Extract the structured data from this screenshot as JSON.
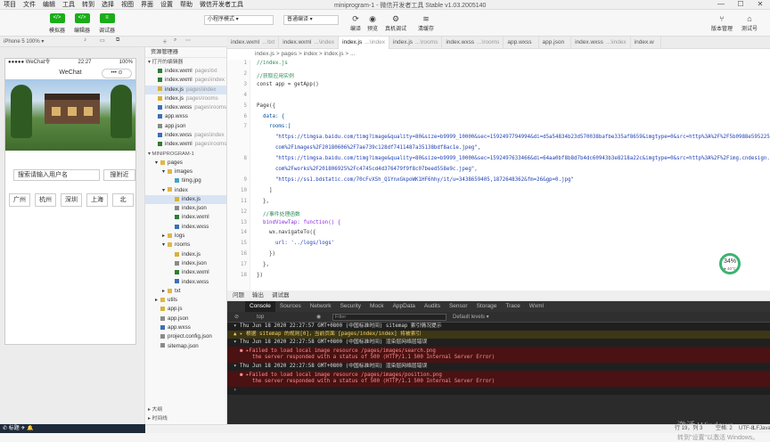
{
  "menu": [
    "项目",
    "文件",
    "编辑",
    "工具",
    "转到",
    "选择",
    "视图",
    "界面",
    "设置",
    "帮助",
    "微信开发者工具"
  ],
  "window_title": "miniprogram-1 - 微信开发者工具 Stable v1.03.2005140",
  "win_controls": {
    "min": "—",
    "max": "☐",
    "close": "✕"
  },
  "toolbar": {
    "simulator": "模拟器",
    "editor": "编辑器",
    "debugger": "调试器",
    "mode": "小程序模式",
    "compile": "普通编译",
    "compile_btn": "编译",
    "preview": "预览",
    "real_debug": "真机调试",
    "clear_cache": "清缓存",
    "version_mgmt": "版本管理",
    "test_account": "测试号",
    "icon_sim": "</>",
    "icon_ed": "</>",
    "icon_dbg": "≡"
  },
  "sim_bar": "iPhone 5 100% ▾",
  "tabs": [
    {
      "name": "index.wxml",
      "dir": "...\\txt"
    },
    {
      "name": "index.wxml",
      "dir": "...\\index"
    },
    {
      "name": "index.js",
      "dir": "...\\index"
    },
    {
      "name": "index.js",
      "dir": "...\\rooms"
    },
    {
      "name": "index.wxss",
      "dir": "...\\rooms"
    },
    {
      "name": "app.wxss",
      "dir": ""
    },
    {
      "name": "app.json",
      "dir": ""
    },
    {
      "name": "index.wxss",
      "dir": "...\\index"
    },
    {
      "name": "index.w",
      "dir": ""
    }
  ],
  "phone": {
    "carrier": "●●●●● WeChat令",
    "time": "22:27",
    "battery": "100%",
    "nav_title": "WeChat",
    "capsule": "•••  ⊙",
    "search_placeholder": "搜索请输入用户名",
    "nearby": "搜附近",
    "cities": [
      "广州",
      "杭州",
      "深圳",
      "上海",
      "北"
    ]
  },
  "explorer": {
    "title": "资源管理器",
    "open_editors": "打开的编辑器",
    "project": "MINIPROGRAM-1",
    "outline": "大纲",
    "timeline": "时间线",
    "open_files": [
      {
        "name": "index.wxml",
        "dir": "pages\\txt",
        "type": "wxml"
      },
      {
        "name": "index.wxml",
        "dir": "pages\\index",
        "type": "wxml"
      },
      {
        "name": "index.js",
        "dir": "pages\\index",
        "type": "js"
      },
      {
        "name": "index.js",
        "dir": "pages\\rooms",
        "type": "js"
      },
      {
        "name": "index.wxss",
        "dir": "pages\\rooms",
        "type": "wxss"
      },
      {
        "name": "app.wxss",
        "dir": "",
        "type": "wxss"
      },
      {
        "name": "app.json",
        "dir": "",
        "type": "json"
      },
      {
        "name": "index.wxss",
        "dir": "pages\\index",
        "type": "wxss"
      },
      {
        "name": "index.wxml",
        "dir": "pages\\rooms",
        "type": "wxml"
      }
    ],
    "tree": [
      {
        "name": "pages",
        "type": "dir",
        "indent": 1,
        "arrow": "▾"
      },
      {
        "name": "images",
        "type": "dir",
        "indent": 2,
        "arrow": "▾"
      },
      {
        "name": "timg.jpg",
        "type": "img",
        "indent": 3,
        "arrow": ""
      },
      {
        "name": "index",
        "type": "dir",
        "indent": 2,
        "arrow": "▾"
      },
      {
        "name": "index.js",
        "type": "js",
        "indent": 3,
        "arrow": "",
        "sel": true
      },
      {
        "name": "index.json",
        "type": "json",
        "indent": 3,
        "arrow": ""
      },
      {
        "name": "index.wxml",
        "type": "wxml",
        "indent": 3,
        "arrow": ""
      },
      {
        "name": "index.wxss",
        "type": "wxss",
        "indent": 3,
        "arrow": ""
      },
      {
        "name": "logs",
        "type": "dir",
        "indent": 2,
        "arrow": "▸"
      },
      {
        "name": "rooms",
        "type": "dir",
        "indent": 2,
        "arrow": "▾"
      },
      {
        "name": "index.js",
        "type": "js",
        "indent": 3,
        "arrow": ""
      },
      {
        "name": "index.json",
        "type": "json",
        "indent": 3,
        "arrow": ""
      },
      {
        "name": "index.wxml",
        "type": "wxml",
        "indent": 3,
        "arrow": ""
      },
      {
        "name": "index.wxss",
        "type": "wxss",
        "indent": 3,
        "arrow": ""
      },
      {
        "name": "txt",
        "type": "dir",
        "indent": 2,
        "arrow": "▸"
      },
      {
        "name": "utils",
        "type": "dir",
        "indent": 1,
        "arrow": "▸"
      },
      {
        "name": "app.js",
        "type": "js",
        "indent": 1,
        "arrow": ""
      },
      {
        "name": "app.json",
        "type": "json",
        "indent": 1,
        "arrow": ""
      },
      {
        "name": "app.wxss",
        "type": "wxss",
        "indent": 1,
        "arrow": ""
      },
      {
        "name": "project.config.json",
        "type": "json",
        "indent": 1,
        "arrow": ""
      },
      {
        "name": "sitemap.json",
        "type": "json",
        "indent": 1,
        "arrow": ""
      }
    ]
  },
  "editor": {
    "breadcrumb": "index.js  >  pages  >  index  >  index.js  >  ...",
    "code": [
      {
        "ln": "1",
        "t": "//index.js",
        "c": "c-com"
      },
      {
        "ln": "2",
        "t": "//获取应用实例",
        "c": "c-com"
      },
      {
        "ln": "3",
        "t": "const app = getApp()",
        "c": ""
      },
      {
        "ln": "4",
        "t": "",
        "c": ""
      },
      {
        "ln": "5",
        "t": "Page({",
        "c": ""
      },
      {
        "ln": "6",
        "t": "  data: {",
        "c": "c-key"
      },
      {
        "ln": "7",
        "t": "    rooms:[",
        "c": "c-key"
      },
      {
        "ln": "",
        "t": "      \"https://timgsa.baidu.com/timg?image&quality=80&size=b9999_10000&sec=1592497794994&di=d5a54834b23d570038bafbe335af8659&imgtype=0&src=http%3A%2F%2F5b0988e595225.cdn.sohucs.",
        "c": "c-str"
      },
      {
        "ln": "",
        "t": "      com%2Fimages%2F20180606%2F7ae739c128df7411487a35138bdf8ac1e.jpeg\",",
        "c": "c-str"
      },
      {
        "ln": "8",
        "t": "      \"https://timgsa.baidu.com/timg?image&quality=80&size=b9999_10000&sec=1592497633466&di=64aa0bf8b8d7b4dc60943b3e8218a22c&imgtype=0&src=http%3A%2F%2Fimg.cndesign.",
        "c": "c-str"
      },
      {
        "ln": "",
        "t": "      com%2Fworks%2F201806925%2Fc4745cd4d376479f9f8c07beed558e9c.jpeg\",",
        "c": "c-str"
      },
      {
        "ln": "9",
        "t": "      \"https://ss1.bdstatic.com/70cFvXSh_Q1YnxGkpoWK1HF6hhy/it/u=3438659405,1872648362&fm=26&gp=0.jpg\"",
        "c": "c-str"
      },
      {
        "ln": "10",
        "t": "    ]",
        "c": ""
      },
      {
        "ln": "11",
        "t": "  },",
        "c": ""
      },
      {
        "ln": "12",
        "t": "  //事件处理函数",
        "c": "c-com"
      },
      {
        "ln": "13",
        "t": "  bindViewTap: function() {",
        "c": "c-kw"
      },
      {
        "ln": "14",
        "t": "    wx.navigateTo({",
        "c": ""
      },
      {
        "ln": "15",
        "t": "      url: '../logs/logs'",
        "c": "c-str"
      },
      {
        "ln": "16",
        "t": "    })",
        "c": ""
      },
      {
        "ln": "17",
        "t": "  },",
        "c": ""
      },
      {
        "ln": "18",
        "t": "})",
        "c": ""
      }
    ]
  },
  "perf": {
    "percent": "34%",
    "label": "● 40°C"
  },
  "devtools": {
    "top_tabs": [
      "问题",
      "输出",
      "调试器"
    ],
    "tabs": [
      "Console",
      "Sources",
      "Network",
      "Security",
      "Mock",
      "AppData",
      "Audits",
      "Sensor",
      "Storage",
      "Trace",
      "Wxml"
    ],
    "context": "top",
    "filter_placeholder": "Filter",
    "levels": "Default levels ▾",
    "logs": [
      {
        "cls": "sysm",
        "t": "▾ Thu Jun 18 2020 22:27:57 GMT+0800 (中国标准时间) sitemap 索引情况提示"
      },
      {
        "cls": "warn",
        "t": "  ▲ ▸ 根据 sitemap 的规则[0]，当前页面 [pages/index/index] 将被索引"
      },
      {
        "cls": "sysm",
        "t": "▾ Thu Jun 18 2020 22:27:58 GMT+0800 (中国标准时间) 渲染层网络层错误"
      },
      {
        "cls": "err",
        "t": "  ● ▸Failed to load local image resource /pages/images/search.png\n      the server responded with a status of 500 (HTTP/1.1 500 Internal Server Error)"
      },
      {
        "cls": "sysm",
        "t": "▾ Thu Jun 18 2020 22:27:58 GMT+0800 (中国标准时间) 渲染层网络层错误"
      },
      {
        "cls": "err",
        "t": "  ● ▸Failed to load local image resource /pages/images/position.png\n      the server responded with a status of 500 (HTTP/1.1 500 Internal Server Error)"
      },
      {
        "cls": "sysm",
        "t": "  ›"
      }
    ]
  },
  "watermark": {
    "line1": "激活 Windows",
    "line2": "转到\"设置\"以激活 Windows。"
  },
  "statusbar": {
    "pos": "行 19，列 3",
    "space": "空格: 2",
    "enc": "UTF-8",
    "eol": "LF",
    "lang": "JavaScript"
  },
  "taskbar": "✆ 标题 ✈ 🔔"
}
